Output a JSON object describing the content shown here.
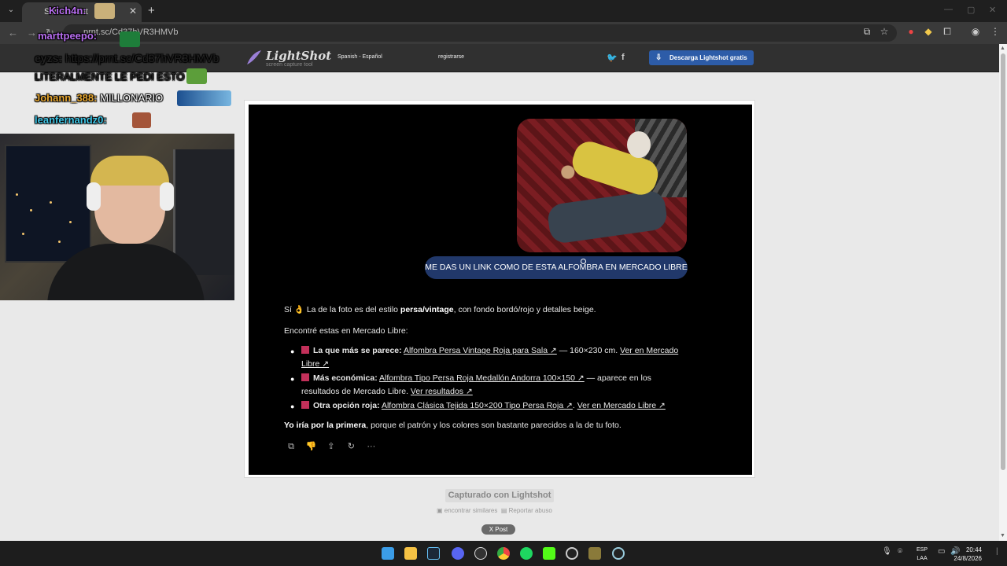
{
  "browser": {
    "tab_title": "Screenshot",
    "url": "prnt.sc/Cd37hVR3HMVb"
  },
  "lightshot": {
    "logo": "LightShot",
    "logo_sub": "screen capture tool",
    "language": "Spanish - Español",
    "register": "registrarse",
    "download": "Descarga Lightshot gratis",
    "captured": "Capturado con Lightshot",
    "similar": "encontrar similares",
    "report": "Reportar abuso",
    "post": "X  Post"
  },
  "overlay": {
    "chat": [
      {
        "user": "Kich4n:",
        "text": "",
        "color": "#b86ef0"
      },
      {
        "user": "marttpeepo:",
        "text": "",
        "color": "#b86ef0"
      },
      {
        "user": "eyzs:",
        "text": "https://prnt.sc/Cd37hVR3HMVb",
        "color": "#ffffff"
      },
      {
        "user": "",
        "text": "LITERALMENTE LE PEDI ESTO",
        "color": "#ffffff"
      },
      {
        "user": "Johann_388:",
        "text": "MILLONARIO",
        "color": "#e5a631"
      },
      {
        "user": "leanfernandz0:",
        "text": "",
        "color": "#3fc7e8"
      }
    ]
  },
  "conversation": {
    "user_message": "ME DAS UN LINK COMO DE ESTA ALFOMBRA EN MERCADO LIBRE",
    "intro_pre": "Sí 👌 La de la foto es del estilo ",
    "intro_bold": "persa/vintage",
    "intro_post": ", con fondo bordó/rojo y detalles beige.",
    "found": "Encontré estas en Mercado Libre:",
    "items": [
      {
        "label": "La que más se parece:",
        "link": "Alfombra Persa Vintage Roja para Sala ↗",
        "rest": " — 160×230 cm. ",
        "link2": "Ver en Mercado Libre ↗"
      },
      {
        "label": "Más económica:",
        "link": "Alfombra Tipo Persa Roja Medallón Andorra 100×150 ↗",
        "rest": " — aparece en los resultados de Mercado Libre. ",
        "link2": "Ver resultados ↗"
      },
      {
        "label": "Otra opción roja:",
        "link": "Alfombra Clásica Tejida 150×200 Tipo Persa Roja ↗",
        "rest": ". ",
        "link2": "Ver en Mercado Libre ↗"
      }
    ],
    "closing_bold": "Yo iría por la primera",
    "closing_rest": ", porque el patrón y los colores son bastante parecidos a la de tu foto."
  },
  "taskbar": {
    "lang_top": "ESP",
    "lang_bottom": "LAA",
    "time": "20:44",
    "date": "24/8/2026"
  }
}
